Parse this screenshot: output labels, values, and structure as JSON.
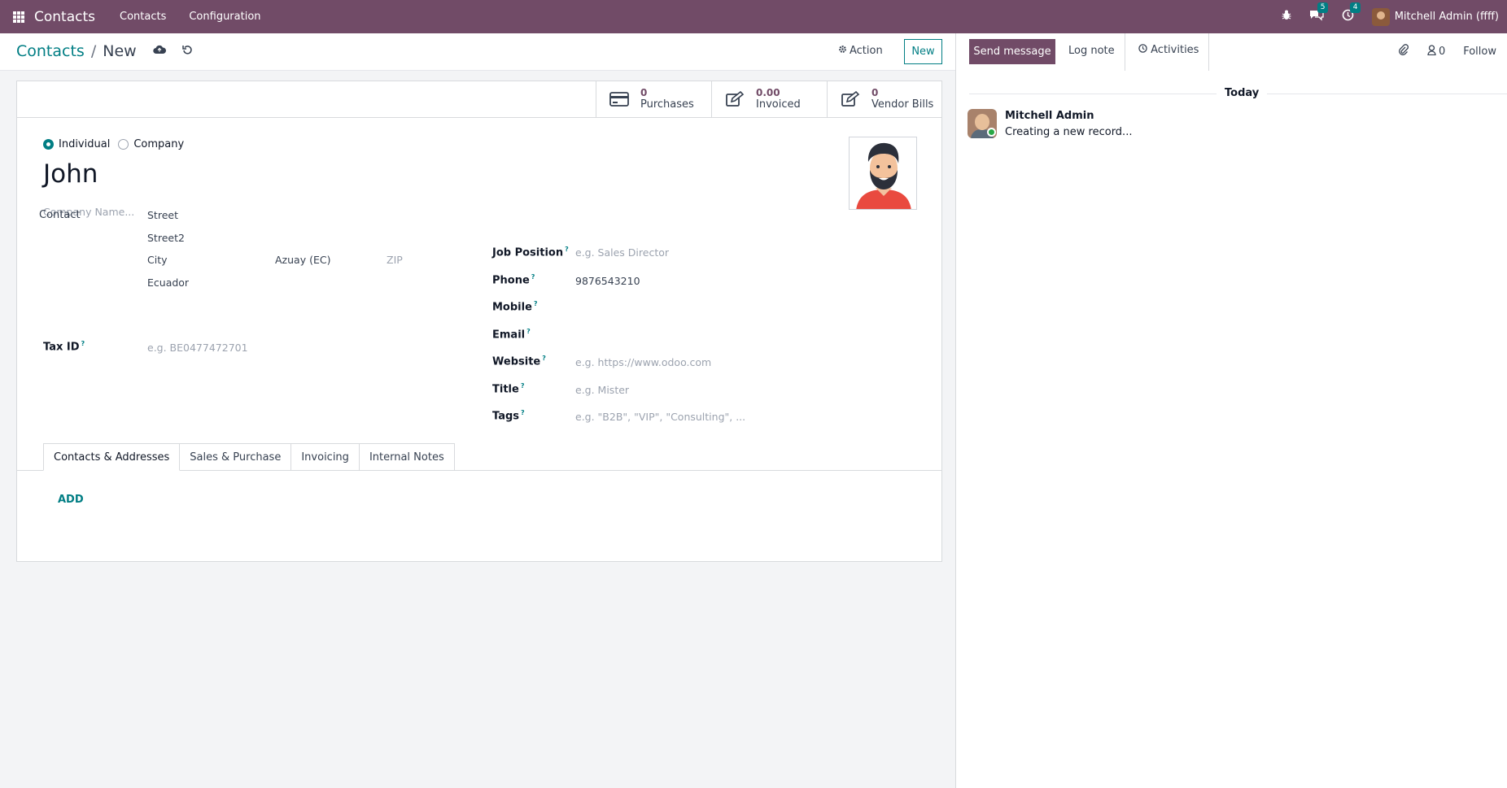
{
  "navbar": {
    "brand": "Contacts",
    "menus": [
      "Contacts",
      "Configuration"
    ],
    "messages_count": "5",
    "activities_count": "4",
    "user": "Mitchell Admin (ffff)"
  },
  "control": {
    "breadcrumb_parent": "Contacts",
    "breadcrumb_current": "New",
    "action_label": "Action",
    "new_label": "New"
  },
  "stats": [
    {
      "value": "0",
      "label": "Purchases",
      "icon": "credit-card-icon"
    },
    {
      "value": "0.00",
      "label": "Invoiced",
      "icon": "edit-icon"
    },
    {
      "value": "0",
      "label": "Vendor Bills",
      "icon": "edit-icon"
    }
  ],
  "form": {
    "type_individual": "Individual",
    "type_company": "Company",
    "name": "John",
    "company_placeholder": "Company Name...",
    "contact_label": "Contact",
    "street_placeholder": "Street",
    "street2_placeholder": "Street2",
    "city_placeholder": "City",
    "state": "Azuay (EC)",
    "zip_placeholder": "ZIP",
    "country": "Ecuador",
    "tax_id_label": "Tax ID",
    "tax_id_placeholder": "e.g. BE0477472701",
    "job_position_label": "Job Position",
    "job_position_placeholder": "e.g. Sales Director",
    "phone_label": "Phone",
    "phone": "9876543210",
    "mobile_label": "Mobile",
    "email_label": "Email",
    "website_label": "Website",
    "website_placeholder": "e.g. https://www.odoo.com",
    "title_label": "Title",
    "title_placeholder": "e.g. Mister",
    "tags_label": "Tags",
    "tags_placeholder": "e.g. \"B2B\", \"VIP\", \"Consulting\", ...",
    "help_mark": "?"
  },
  "tabs": [
    "Contacts & Addresses",
    "Sales & Purchase",
    "Invoicing",
    "Internal Notes"
  ],
  "add_label": "ADD",
  "chatter": {
    "send_message": "Send message",
    "log_note": "Log note",
    "activities": "Activities",
    "followers_count": "0",
    "follow": "Follow",
    "today": "Today",
    "author": "Mitchell Admin",
    "body": "Creating a new record..."
  },
  "colors": {
    "brand": "#714b67",
    "accent": "#017e84"
  }
}
